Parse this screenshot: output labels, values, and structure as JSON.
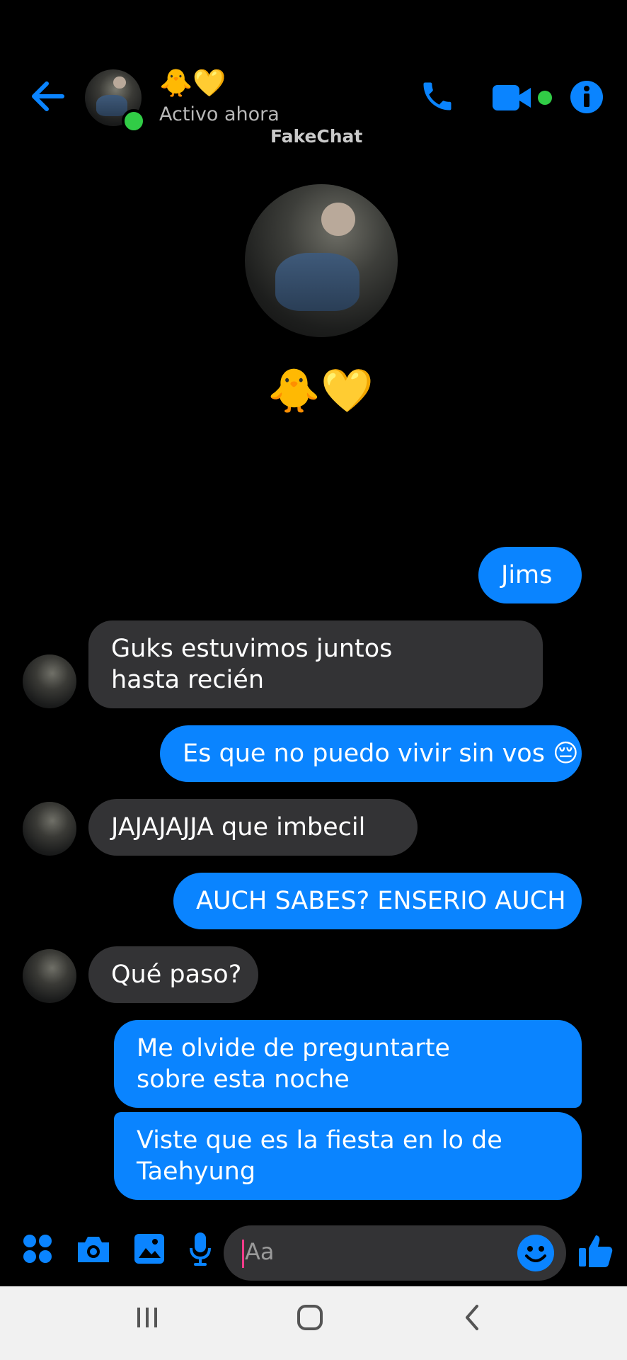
{
  "header": {
    "contact_name": "🐥💛",
    "status": "Activo ahora",
    "watermark": "FakeChat"
  },
  "profile": {
    "name": "🐥💛"
  },
  "messages": [
    {
      "side": "out",
      "text": "Jims"
    },
    {
      "side": "in",
      "text": "Guks estuvimos juntos hasta recién"
    },
    {
      "side": "out",
      "text": "Es que no puedo vivir sin vos 😔"
    },
    {
      "side": "in",
      "text": "JAJAJAJJA que imbecil"
    },
    {
      "side": "out",
      "text": "AUCH SABES? ENSERIO AUCH"
    },
    {
      "side": "in",
      "text": "Qué paso?"
    },
    {
      "side": "out",
      "text": "Me olvide de preguntarte sobre esta noche"
    },
    {
      "side": "out",
      "text": "Viste que es la fiesta en lo de Taehyung"
    }
  ],
  "composer": {
    "placeholder": "Aa"
  },
  "colors": {
    "accent": "#0a84ff",
    "incoming": "#333335",
    "online": "#31cc46"
  },
  "icons": [
    "back-arrow-icon",
    "phone-icon",
    "video-camera-icon",
    "info-icon",
    "apps-grid-icon",
    "camera-icon",
    "image-icon",
    "microphone-icon",
    "emoji-icon",
    "thumbs-up-icon",
    "recent-apps-icon",
    "home-icon",
    "nav-back-icon"
  ]
}
